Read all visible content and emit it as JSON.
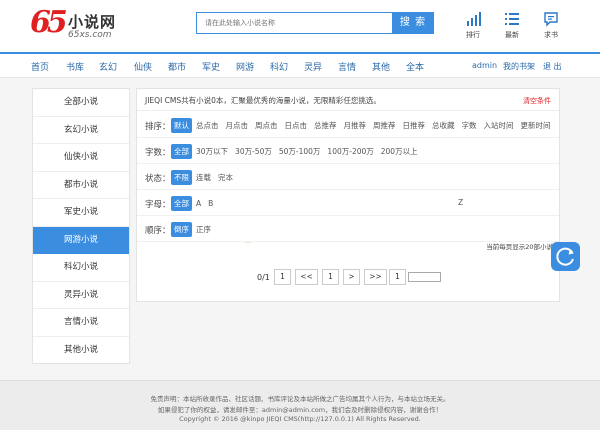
{
  "brand": {
    "digits": "65",
    "name_cn": "小说网",
    "domain": "65xs.com"
  },
  "search": {
    "placeholder": "请在此处输入小说名称",
    "button": "搜 索"
  },
  "tools": [
    {
      "label": "排行",
      "icon": "bar-chart-icon"
    },
    {
      "label": "最新",
      "icon": "list-icon"
    },
    {
      "label": "求书",
      "icon": "message-icon"
    }
  ],
  "nav": {
    "items": [
      "首页",
      "书库",
      "玄幻",
      "仙侠",
      "都市",
      "军史",
      "网游",
      "科幻",
      "灵异",
      "言情",
      "其他",
      "全本"
    ],
    "username": "admin",
    "bookshelf": "我的书架",
    "logout": "退 出"
  },
  "sidebar": {
    "items": [
      "全部小说",
      "玄幻小说",
      "仙侠小说",
      "都市小说",
      "军史小说",
      "网游小说",
      "科幻小说",
      "灵异小说",
      "言情小说",
      "其他小说"
    ],
    "active_index": 5
  },
  "notice": {
    "text": "JIEQI CMS共有小说0本，汇聚最优秀的海量小说，无限精彩任您挑选。",
    "clear": "清空条件"
  },
  "filters": {
    "sort": {
      "label": "排序：",
      "options": [
        "默认",
        "总点击",
        "月点击",
        "周点击",
        "日点击",
        "总推荐",
        "月推荐",
        "周推荐",
        "日推荐",
        "总收藏",
        "字数",
        "入站时间",
        "更新时间"
      ],
      "selected": 0
    },
    "words": {
      "label": "字数：",
      "options": [
        "全部",
        "30万以下",
        "30万-50万",
        "50万-100万",
        "100万-200万",
        "200万以上"
      ],
      "selected": 0
    },
    "status": {
      "label": "状态：",
      "options": [
        "不限",
        "连载",
        "完本"
      ],
      "selected": 0
    },
    "letter": {
      "label": "字母：",
      "options": [
        "全部",
        "A",
        "B"
      ],
      "tail_option": "Z",
      "selected": 0
    },
    "order": {
      "label": "顺序：",
      "options": [
        "倒序",
        "正序"
      ],
      "selected": 0
    }
  },
  "tick": "…",
  "page_info": "当前每页显示20部小说",
  "pager": {
    "count": "0/1",
    "buttons": [
      "1",
      "<<",
      "1",
      ">",
      ">>",
      "1"
    ],
    "jump_value": ""
  },
  "footer": {
    "line1": "免责声明：本站所收录作品、社区话题、书库评论及本站所做之广告均属其个人行为，与本站立场无关。",
    "line2": "如果侵犯了你的权益，请发邮件至：admin@admin.com，我们会及时删除侵权内容，谢谢合作！",
    "line3": "Copyright © 2016 @kinpo JIEQI CMS(http://127.0.0.1) All Rights Reserved."
  },
  "colors": {
    "accent": "#3b8de0",
    "logo_red": "#e02020",
    "clear_red": "#e02020",
    "footer_bg": "#ececec"
  }
}
